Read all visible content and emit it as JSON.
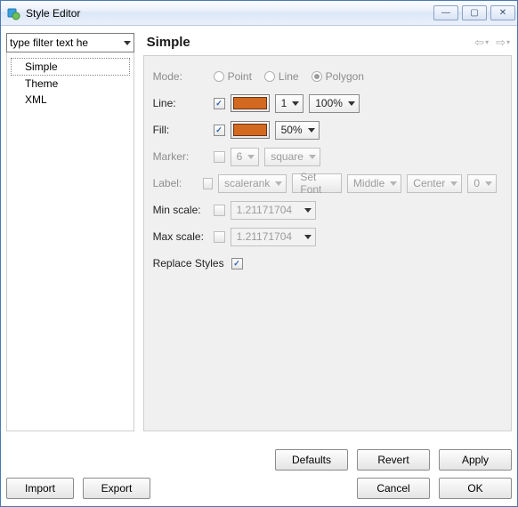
{
  "window": {
    "title": "Style Editor"
  },
  "filter": {
    "placeholder": "type filter text he"
  },
  "tree": {
    "items": [
      "Simple",
      "Theme",
      "XML"
    ],
    "selected": 0
  },
  "header": {
    "title": "Simple"
  },
  "mode": {
    "label": "Mode:",
    "options": [
      "Point",
      "Line",
      "Polygon"
    ],
    "selected": 2
  },
  "line": {
    "label": "Line:",
    "checked": true,
    "color": "#d2691e",
    "width": "1",
    "opacity": "100%"
  },
  "fill": {
    "label": "Fill:",
    "checked": true,
    "color": "#d2691e",
    "opacity": "50%"
  },
  "marker": {
    "label": "Marker:",
    "checked": false,
    "size": "6",
    "shape": "square"
  },
  "labels": {
    "label": "Label:",
    "checked": false,
    "field": "scalerank",
    "setFont": "Set Font",
    "vAlign": "Middle",
    "hAlign": "Center",
    "offset": "0"
  },
  "minScale": {
    "label": "Min scale:",
    "checked": false,
    "value": "1.21171704"
  },
  "maxScale": {
    "label": "Max scale:",
    "checked": false,
    "value": "1.21171704"
  },
  "replace": {
    "label": "Replace Styles",
    "checked": true
  },
  "buttons": {
    "defaults": "Defaults",
    "revert": "Revert",
    "apply": "Apply",
    "import": "Import",
    "export": "Export",
    "cancel": "Cancel",
    "ok": "OK"
  }
}
